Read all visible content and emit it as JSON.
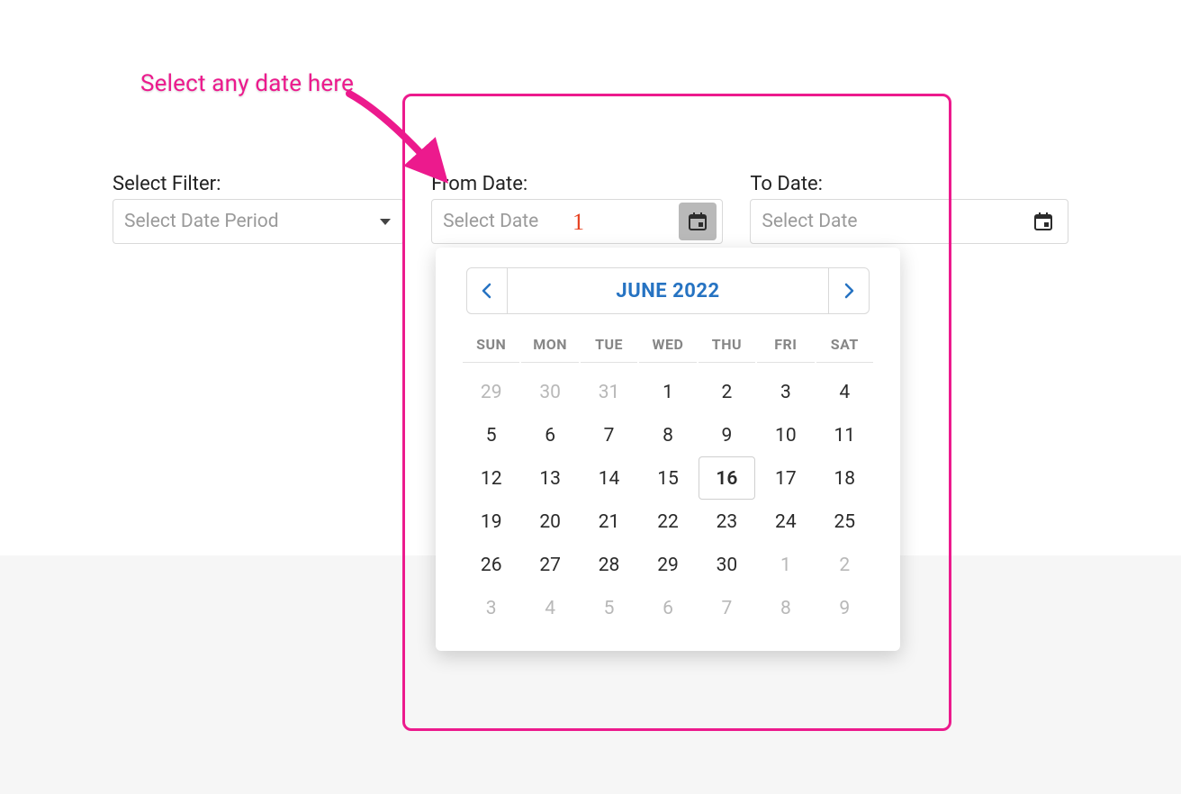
{
  "annotation": {
    "text": "Select any date here",
    "step_number": "1"
  },
  "filters": {
    "select_label": "Select Filter:",
    "select_placeholder": "Select Date Period",
    "from_label": "From Date:",
    "from_placeholder": "Select Date",
    "to_label": "To Date:",
    "to_placeholder": "Select Date"
  },
  "datepicker": {
    "title": "JUNE 2022",
    "dow": [
      "SUN",
      "MON",
      "TUE",
      "WED",
      "THU",
      "FRI",
      "SAT"
    ],
    "today": 16,
    "weeks": [
      {
        "days": [
          {
            "n": "29",
            "muted": true
          },
          {
            "n": "30",
            "muted": true
          },
          {
            "n": "31",
            "muted": true
          },
          {
            "n": "1"
          },
          {
            "n": "2"
          },
          {
            "n": "3"
          },
          {
            "n": "4"
          }
        ]
      },
      {
        "days": [
          {
            "n": "5"
          },
          {
            "n": "6"
          },
          {
            "n": "7"
          },
          {
            "n": "8"
          },
          {
            "n": "9"
          },
          {
            "n": "10"
          },
          {
            "n": "11"
          }
        ]
      },
      {
        "days": [
          {
            "n": "12"
          },
          {
            "n": "13"
          },
          {
            "n": "14"
          },
          {
            "n": "15"
          },
          {
            "n": "16",
            "today": true
          },
          {
            "n": "17"
          },
          {
            "n": "18"
          }
        ]
      },
      {
        "days": [
          {
            "n": "19"
          },
          {
            "n": "20"
          },
          {
            "n": "21"
          },
          {
            "n": "22"
          },
          {
            "n": "23"
          },
          {
            "n": "24"
          },
          {
            "n": "25"
          }
        ]
      },
      {
        "days": [
          {
            "n": "26"
          },
          {
            "n": "27"
          },
          {
            "n": "28"
          },
          {
            "n": "29"
          },
          {
            "n": "30"
          },
          {
            "n": "1",
            "muted": true
          },
          {
            "n": "2",
            "muted": true
          }
        ]
      },
      {
        "days": [
          {
            "n": "3",
            "muted": true
          },
          {
            "n": "4",
            "muted": true
          },
          {
            "n": "5",
            "muted": true
          },
          {
            "n": "6",
            "muted": true
          },
          {
            "n": "7",
            "muted": true
          },
          {
            "n": "8",
            "muted": true
          },
          {
            "n": "9",
            "muted": true
          }
        ]
      }
    ]
  }
}
